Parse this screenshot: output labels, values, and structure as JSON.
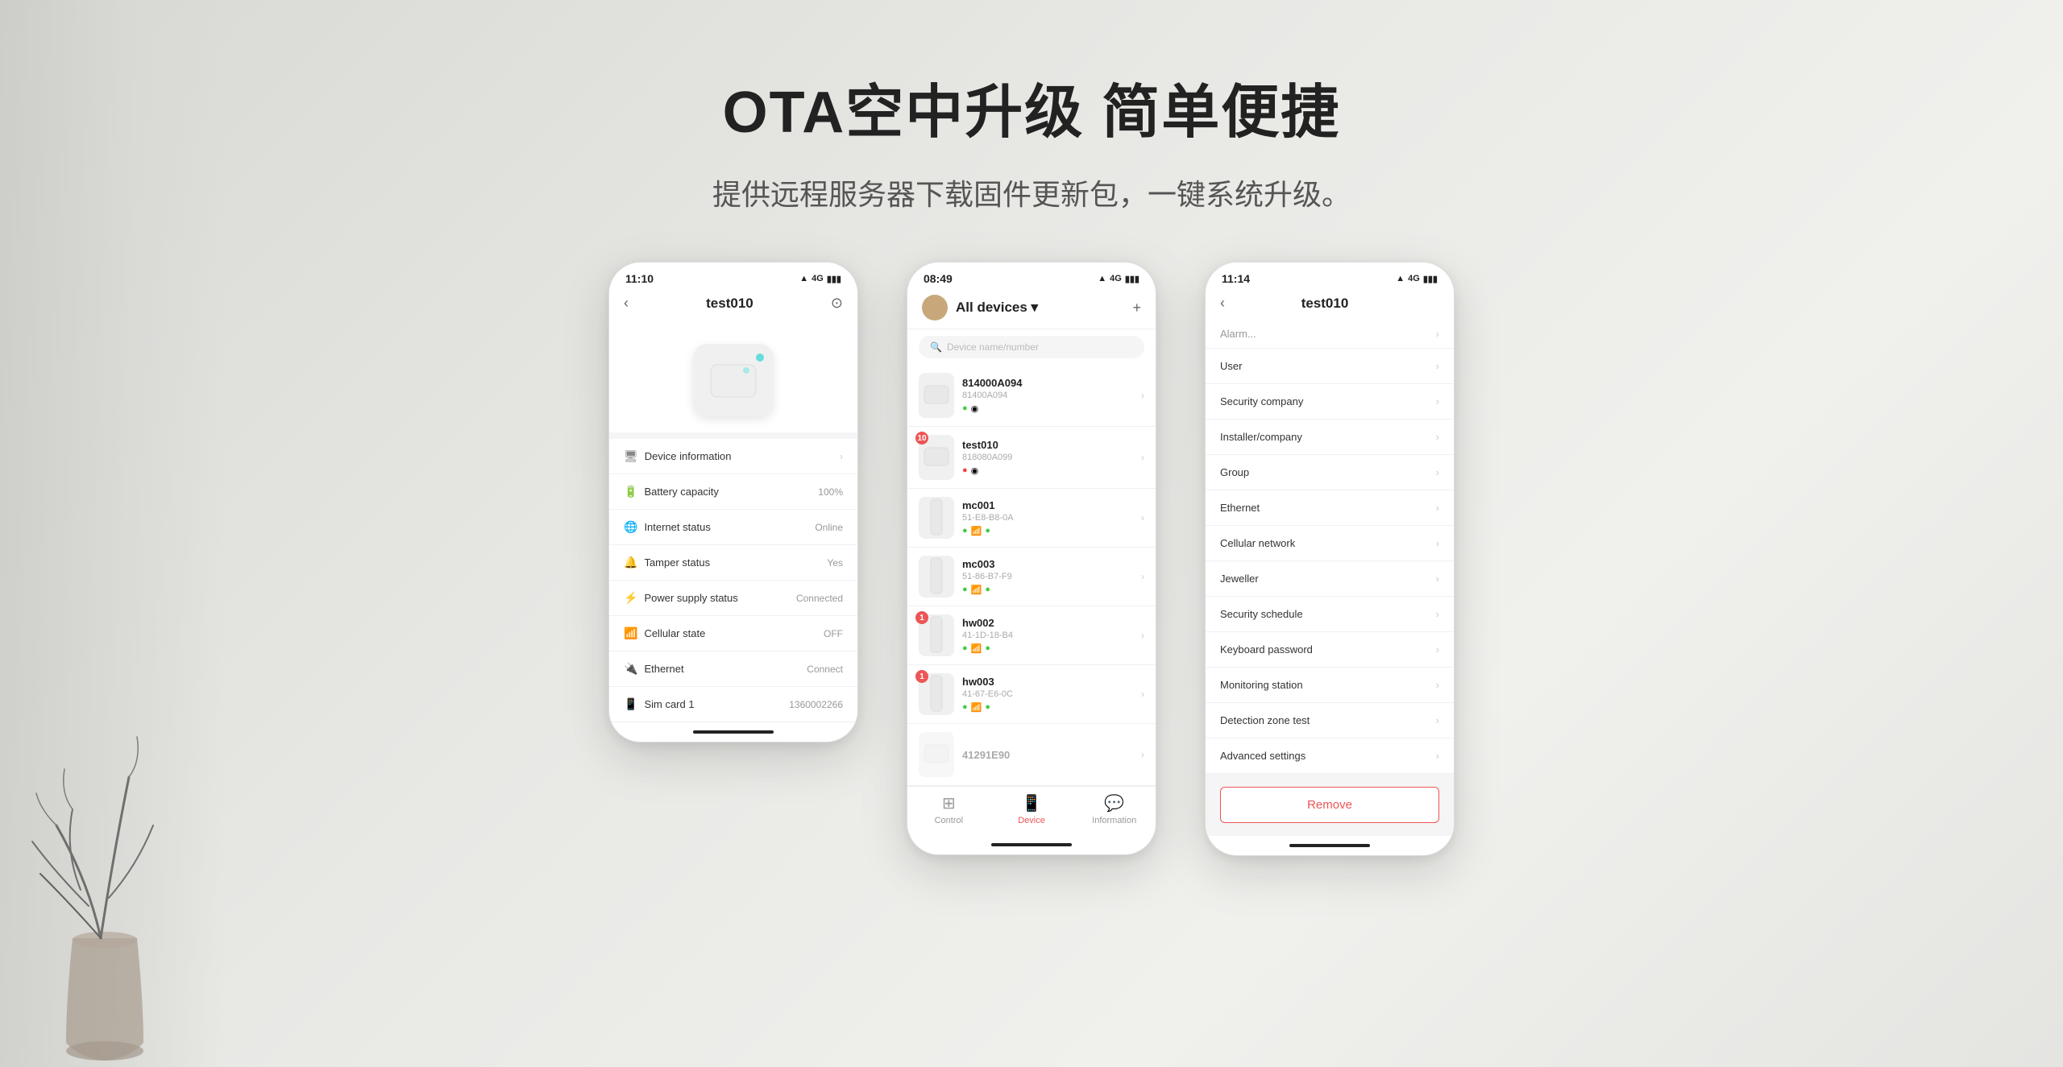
{
  "page": {
    "title": "OTA空中升级 简单便捷",
    "subtitle": "提供远程服务器下载固件更新包，一键系统升级。",
    "bg_color": "#e8e8e5"
  },
  "phone1": {
    "status_bar": {
      "time": "11:10",
      "signal": "4G",
      "battery": "🔋"
    },
    "nav": {
      "title": "test010",
      "back_icon": "‹",
      "settings_icon": "⊙"
    },
    "device_info_label": "Device information",
    "items": [
      {
        "icon": "🖥",
        "label": "Device information",
        "value": "",
        "arrow": true
      },
      {
        "icon": "🔋",
        "label": "Battery capacity",
        "value": "100%",
        "arrow": false
      },
      {
        "icon": "🌐",
        "label": "Internet status",
        "value": "Online",
        "arrow": false
      },
      {
        "icon": "🔔",
        "label": "Tamper status",
        "value": "Yes",
        "arrow": false
      },
      {
        "icon": "⚡",
        "label": "Power supply status",
        "value": "Connected",
        "arrow": false
      },
      {
        "icon": "📶",
        "label": "Cellular state",
        "value": "OFF",
        "arrow": false
      },
      {
        "icon": "🔌",
        "label": "Ethernet",
        "value": "Connect",
        "arrow": false
      },
      {
        "icon": "📱",
        "label": "Sim card 1",
        "value": "1360002266",
        "arrow": false
      }
    ]
  },
  "phone2": {
    "status_bar": {
      "time": "08:49",
      "signal": "4G"
    },
    "nav": {
      "title": "All devices",
      "add_icon": "+"
    },
    "search_placeholder": "Device name/number",
    "devices": [
      {
        "name": "814000A094",
        "id": "81400A094",
        "badge": null,
        "thumb_type": "box"
      },
      {
        "name": "test010",
        "id": "818080A099",
        "badge": "10",
        "badge_color": "red",
        "thumb_type": "box"
      },
      {
        "name": "mc001",
        "id": "51-E8-B8-0A",
        "badge": null,
        "thumb_type": "stick"
      },
      {
        "name": "mc003",
        "id": "51-86-B7-F9",
        "badge": null,
        "thumb_type": "stick"
      },
      {
        "name": "hw002",
        "id": "41-1D-18-B4",
        "badge": "1",
        "badge_color": "red",
        "thumb_type": "stick"
      },
      {
        "name": "hw003",
        "id": "41-67-E6-0C",
        "badge": "1",
        "badge_color": "red",
        "thumb_type": "stick"
      },
      {
        "name": "41291E90",
        "id": "",
        "badge": null,
        "thumb_type": "box"
      }
    ],
    "bottom_nav": [
      {
        "label": "Control",
        "icon": "⊞",
        "active": false
      },
      {
        "label": "Device",
        "icon": "📱",
        "active": true
      },
      {
        "label": "Information",
        "icon": "💬",
        "active": false
      }
    ]
  },
  "phone3": {
    "status_bar": {
      "time": "11:14",
      "signal": "4G"
    },
    "nav": {
      "title": "test010",
      "back_icon": "‹"
    },
    "partial_top": {
      "label": "Alarm...",
      "value": "..."
    },
    "settings": [
      {
        "label": "User"
      },
      {
        "label": "Security company"
      },
      {
        "label": "Installer/company"
      },
      {
        "label": "Group"
      },
      {
        "label": "Ethernet"
      },
      {
        "label": "Cellular network"
      },
      {
        "label": "Jeweller"
      },
      {
        "label": "Security schedule"
      },
      {
        "label": "Keyboard password"
      },
      {
        "label": "Monitoring station"
      },
      {
        "label": "Detection zone test"
      },
      {
        "label": "Advanced settings"
      }
    ],
    "remove_button_label": "Remove"
  }
}
